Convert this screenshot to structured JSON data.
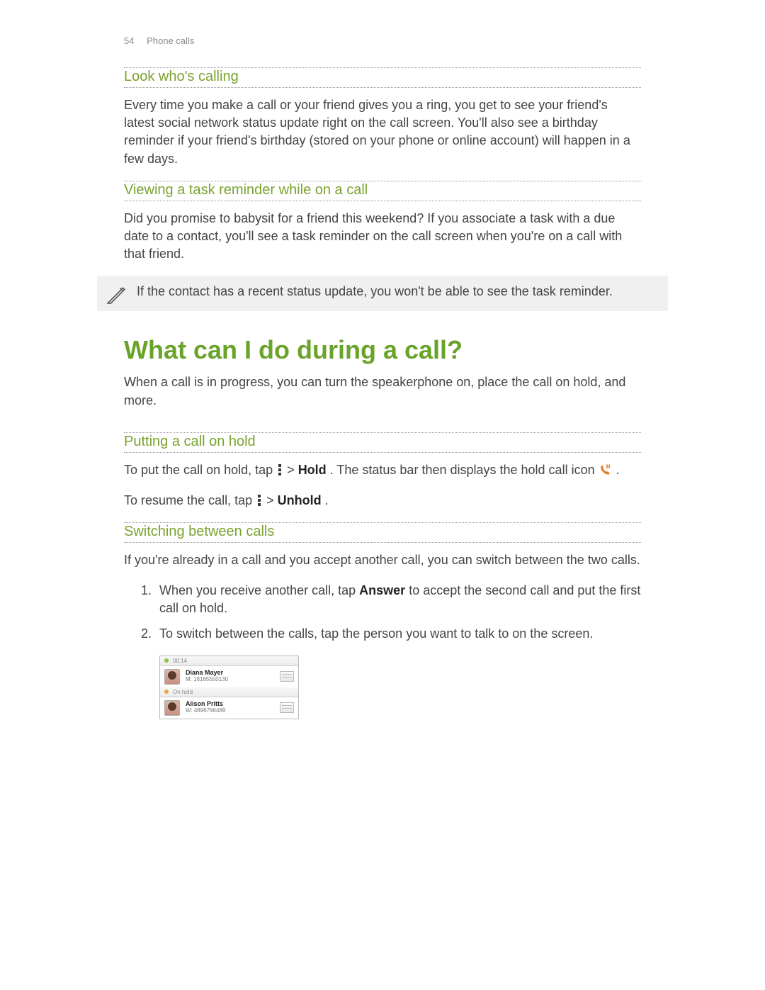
{
  "header": {
    "page_number": "54",
    "section": "Phone calls"
  },
  "section_look": {
    "title": "Look who's calling",
    "body": "Every time you make a call or your friend gives you a ring, you get to see your friend's latest social network status update right on the call screen. You'll also see a birthday reminder if your friend's birthday (stored on your phone or online account) will happen in a few days."
  },
  "section_task": {
    "title": "Viewing a task reminder while on a call",
    "body": "Did you promise to babysit for a friend this weekend? If you associate a task with a due date to a contact, you'll see a task reminder on the call screen when you're on a call with that friend.",
    "note": "If the contact has a recent status update, you won't be able to see the task reminder."
  },
  "section_during": {
    "title": "What can I do during a call?",
    "intro": "When a call is in progress, you can turn the speakerphone on, place the call on hold, and more."
  },
  "section_hold": {
    "title": "Putting a call on hold",
    "p1_a": "To put the call on hold, tap ",
    "p1_b": " > ",
    "p1_hold": "Hold",
    "p1_c": ". The status bar then displays the hold call icon ",
    "p1_d": ".",
    "p2_a": "To resume the call, tap ",
    "p2_b": " > ",
    "p2_unhold": "Unhold",
    "p2_c": "."
  },
  "section_switch": {
    "title": "Switching between calls",
    "intro": "If you're already in a call and you accept another call, you can switch between the two calls.",
    "step1_a": "When you receive another call, tap ",
    "step1_answer": "Answer",
    "step1_b": " to accept the second call and put the first call on hold.",
    "step2": "To switch between the calls, tap the person you want to talk to on the screen."
  },
  "call_switch": {
    "status_active": "00:14",
    "status_hold": "On hold",
    "entries": [
      {
        "name": "Diana Mayer",
        "number": "M: 16165550130"
      },
      {
        "name": "Alison Pritts",
        "number": "W: 4896796489"
      }
    ]
  }
}
